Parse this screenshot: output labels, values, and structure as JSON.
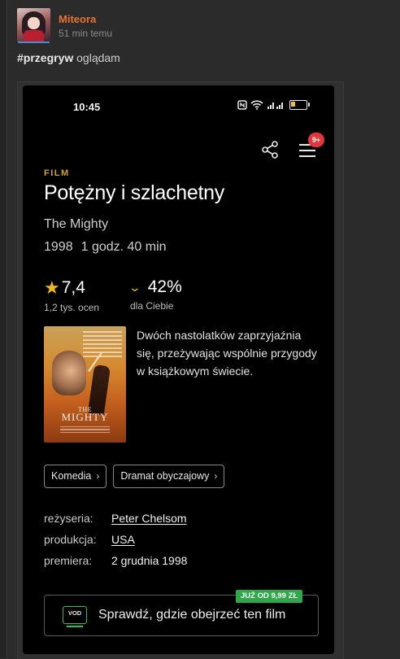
{
  "post": {
    "author": "Miteora",
    "time": "51 min temu",
    "tag": "#przegryw",
    "text": " oglądam"
  },
  "phone": {
    "status_time": "10:45",
    "status_icons_text": "⁵⁵ᵢₗₗ",
    "battery_level": 0.3,
    "badge": "9+"
  },
  "movie": {
    "kind": "FILM",
    "title": "Potężny i szlachetny",
    "original_title": "The Mighty",
    "year": "1998",
    "duration": "1 godz. 40 min",
    "rating_value": "7,4",
    "rating_count": "1,2 tys. ocen",
    "match_value": "42%",
    "match_label": "dla Ciebie",
    "poster_title_small": "THE",
    "poster_title": "MIGHTY",
    "synopsis": "Dwóch nastolatków zaprzyjaźnia się, przeżywając wspólnie przygody w książkowym świecie.",
    "genres": [
      "Komedia",
      "Dramat obyczajowy"
    ],
    "details": [
      {
        "label": "reżyseria:",
        "value": "Peter Chelsom",
        "link": true
      },
      {
        "label": "produkcja:",
        "value": "USA",
        "link": true
      },
      {
        "label": "premiera:",
        "value": "2 grudnia 1998",
        "link": false
      }
    ]
  },
  "vod": {
    "price_badge": "JUŻ OD 9,99 ZŁ",
    "icon_text": "VOD",
    "label": "Sprawdź, gdzie obejrzeć ten film"
  },
  "colors": {
    "author": "#e8722f",
    "accent": "#d4a22b",
    "star": "#f0b81c",
    "badge": "#e3363c",
    "vod_green": "#2fa84a"
  },
  "icons": [
    "share-icon",
    "menu-icon",
    "star-icon",
    "chevron-down-icon",
    "chevron-right-icon",
    "vod-icon",
    "wifi-icon",
    "nfc-icon",
    "battery-icon"
  ]
}
